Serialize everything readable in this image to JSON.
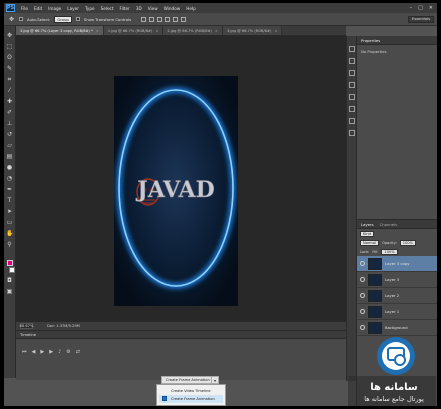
{
  "menubar": {
    "logo": "PS",
    "items": [
      "File",
      "Edit",
      "Image",
      "Layer",
      "Type",
      "Select",
      "Filter",
      "3D",
      "View",
      "Window",
      "Help"
    ],
    "window_controls": [
      "–",
      "□",
      "✕"
    ]
  },
  "options": {
    "auto_select_label": "Auto-Select:",
    "auto_select_value": "Group",
    "show_transform_label": "Show Transform Controls",
    "workspace": "Essentials"
  },
  "tabs": [
    {
      "label": "3.jpg @ 66.7% (Layer 3 copy, RGB/8#) *",
      "active": true
    },
    {
      "label": "1.jpg @ 66.7% (RGB/8#)",
      "active": false
    },
    {
      "label": "2.jpg @ 66.7% (RGB/8#)",
      "active": false
    },
    {
      "label": "3.jpg @ 66.7% (RGB/8#)",
      "active": false
    }
  ],
  "document": {
    "artwork_text": "JAVAD",
    "colors": {
      "background": "#071628",
      "ring": "#3aa8ff",
      "text": "#c9c9d2",
      "skull": "#b2331f"
    }
  },
  "status": {
    "zoom": "66.67%",
    "doc_info": "Doc: 1.37M/9.29M"
  },
  "timeline": {
    "title": "Timeline",
    "create_button": "Create Frame Animation",
    "dropdown": [
      {
        "label": "Create Video Timeline",
        "checked": false
      },
      {
        "label": "Create Frame Animation",
        "checked": true
      }
    ]
  },
  "properties": {
    "tabs": [
      "Properties"
    ],
    "body": "No Properties"
  },
  "layers_panel": {
    "tabs": [
      "Layers",
      "Channels"
    ],
    "kind_label": "Kind",
    "blend_mode": "Normal",
    "opacity_label": "Opacity:",
    "opacity_value": "100%",
    "lock_label": "Lock:",
    "fill_label": "Fill:",
    "fill_value": "100%",
    "layers": [
      {
        "name": "Layer 3 copy",
        "selected": true
      },
      {
        "name": "Layer 3",
        "selected": false
      },
      {
        "name": "Layer 2",
        "selected": false
      },
      {
        "name": "Layer 1",
        "selected": false
      },
      {
        "name": "Background",
        "selected": false
      }
    ]
  },
  "watermark": {
    "line1": "سامانه ها",
    "line2": "پورتال جامع سامانه ها"
  }
}
